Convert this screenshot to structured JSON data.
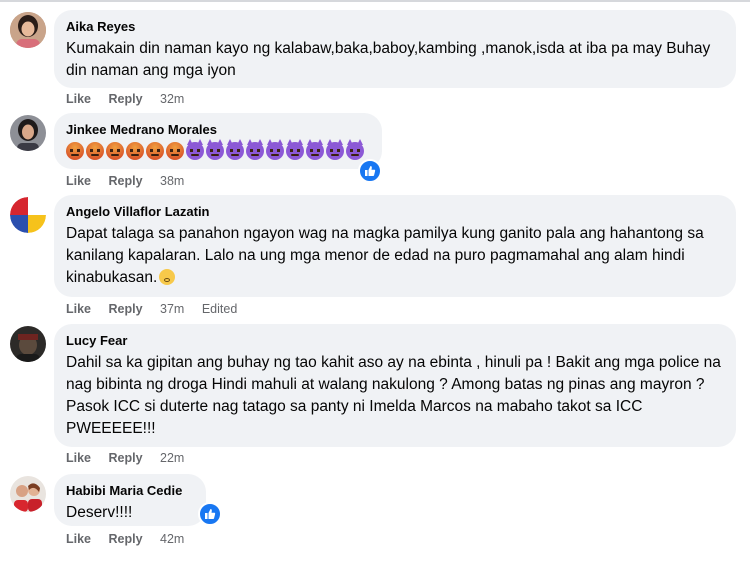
{
  "comments": [
    {
      "author": "Aika Reyes",
      "text": "Kumakain din naman kayo ng kalabaw,baka,baboy,kambing ,manok,isda at iba pa may Buhay din naman ang mga iyon",
      "like": "Like",
      "reply": "Reply",
      "time": "32m"
    },
    {
      "author": "Jinkee Medrano Morales",
      "reactions": [
        "angry",
        "angry",
        "angry",
        "angry",
        "angry",
        "angry",
        "devil",
        "devil",
        "devil",
        "devil",
        "devil",
        "devil",
        "devil",
        "devil",
        "devil"
      ],
      "like": "Like",
      "reply": "Reply",
      "time": "38m"
    },
    {
      "author": "Angelo Villaflor Lazatin",
      "text": "Dapat talaga sa panahon ngayon wag na magka pamilya kung ganito pala ang hahantong sa kanilang kapalaran. Lalo na ung mga menor de edad na puro pagmamahal ang alam hindi kinabukasan.",
      "like": "Like",
      "reply": "Reply",
      "time": "37m",
      "edited": "Edited"
    },
    {
      "author": "Lucy Fear",
      "text": "Dahil sa ka gipitan ang buhay ng tao kahit aso ay na ebinta , hinuli pa ! Bakit ang mga police na nag bibinta ng droga Hindi mahuli at walang nakulong ? Among batas ng pinas ang mayron ? Pasok ICC si duterte nag tatago sa panty ni Imelda Marcos na mabaho takot sa ICC PWEEEEE!!!",
      "like": "Like",
      "reply": "Reply",
      "time": "22m"
    },
    {
      "author": "Habibi Maria Cedie",
      "text": "Deserv!!!!",
      "like": "Like",
      "reply": "Reply",
      "time": "42m"
    }
  ],
  "colors": {
    "bubble": "#f0f2f5",
    "meta": "#65676b",
    "like_badge": "#1877f2"
  }
}
